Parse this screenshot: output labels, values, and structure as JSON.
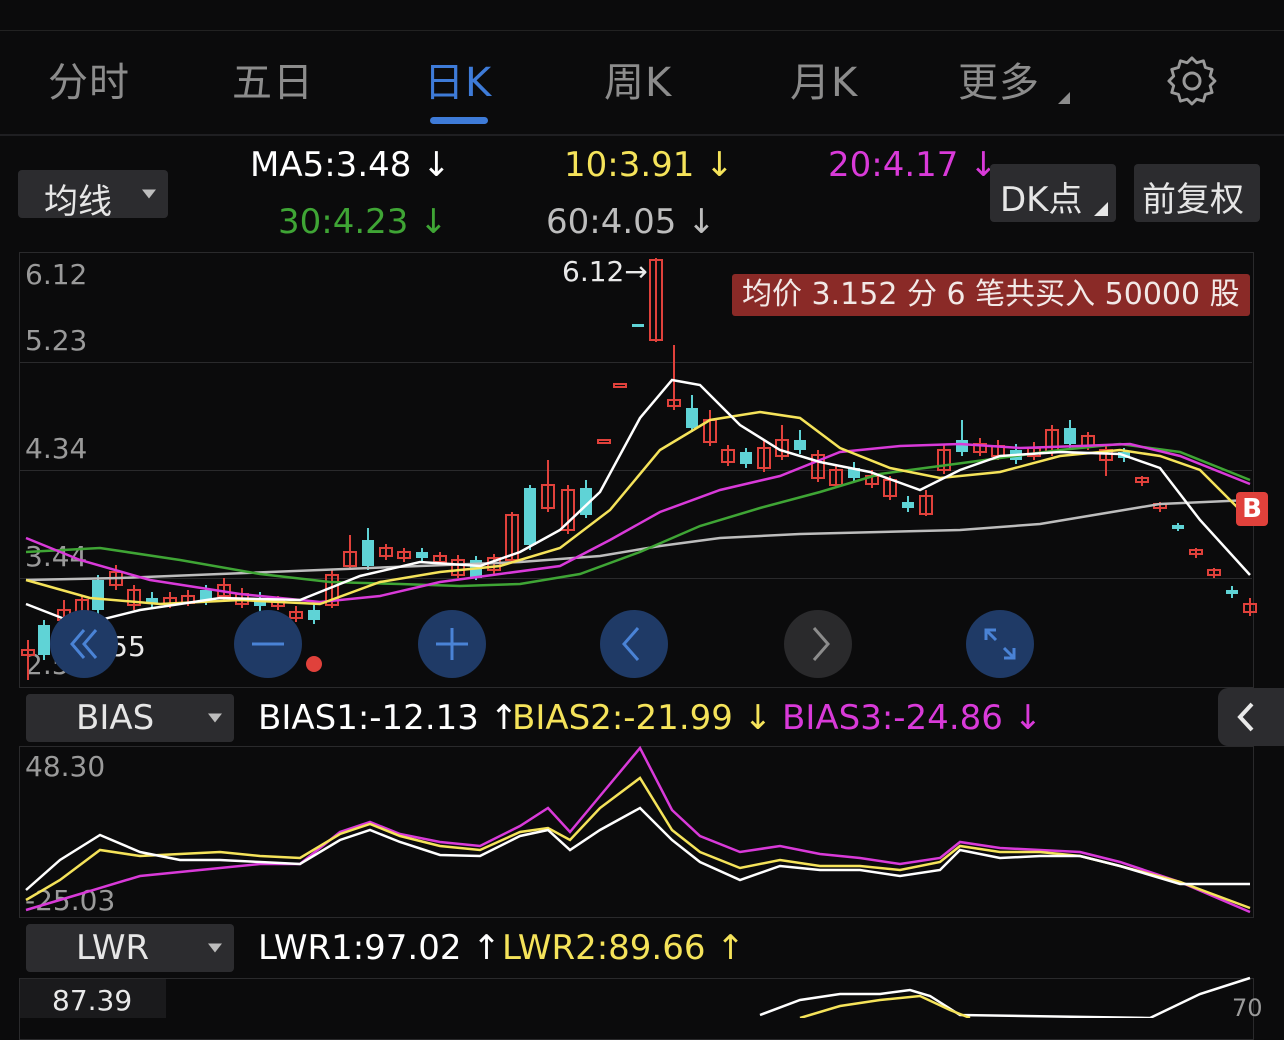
{
  "tabs": [
    {
      "label": "分时",
      "active": false
    },
    {
      "label": "五日",
      "active": false
    },
    {
      "label": "日K",
      "active": true
    },
    {
      "label": "周K",
      "active": false
    },
    {
      "label": "月K",
      "active": false
    },
    {
      "label": "更多",
      "active": false
    }
  ],
  "ma_selector": {
    "label": "均线"
  },
  "ma_values": {
    "ma5": "MA5:3.48",
    "ma10": "10:3.91",
    "ma20": "20:4.17",
    "ma30": "30:4.23",
    "ma60": "60:4.05",
    "arrow_down": "↓",
    "arrow_up": "↑"
  },
  "buttons": {
    "dk": "DK点",
    "adjust": "前复权"
  },
  "main_chart": {
    "y_labels": [
      "6.12",
      "5.23",
      "4.34",
      "3.44",
      "2.55"
    ],
    "high_marker": "6.12→",
    "low_marker": "←2.55",
    "note": "均价 3.152 分 6 笔共买入 50000 股",
    "b_badge": "B"
  },
  "bias": {
    "selector": "BIAS",
    "bias1": "BIAS1:-12.13",
    "bias2": "BIAS2:-21.99",
    "bias3": "BIAS3:-24.86",
    "y_top": "48.30",
    "y_bottom": "-25.03"
  },
  "lwr": {
    "selector": "LWR",
    "lwr1": "LWR1:97.02",
    "lwr2": "LWR2:89.66",
    "y_top": "87.39",
    "y_right": "70"
  },
  "colors": {
    "up": "#e0413b",
    "down": "#5fd3d6",
    "ma5": "#ffffff",
    "ma10": "#f5e35a",
    "ma20": "#d93ad9",
    "ma30": "#3fa535",
    "ma60": "#bdbdbd",
    "accent": "#3e7bd8"
  }
}
